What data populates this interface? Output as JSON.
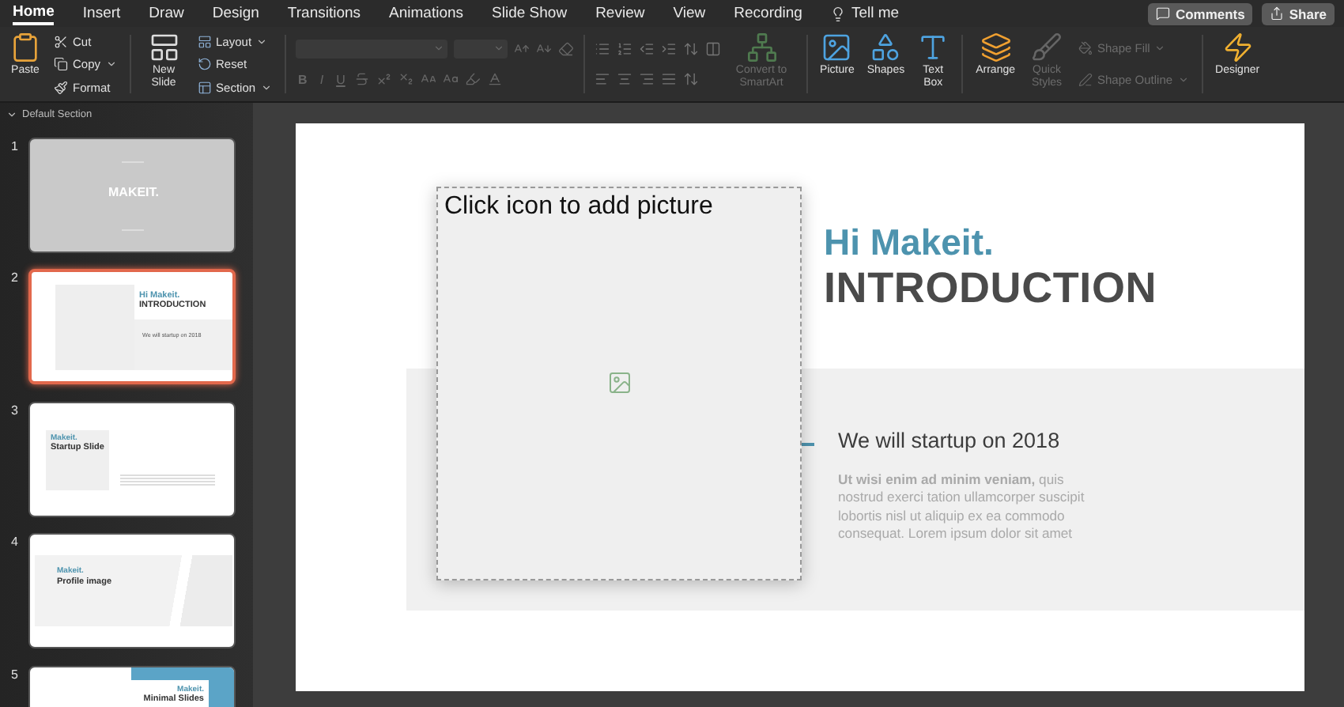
{
  "tabs": [
    {
      "label": "Home",
      "selected": true
    },
    {
      "label": "Insert",
      "selected": false
    },
    {
      "label": "Draw",
      "selected": false
    },
    {
      "label": "Design",
      "selected": false
    },
    {
      "label": "Transitions",
      "selected": false
    },
    {
      "label": "Animations",
      "selected": false
    },
    {
      "label": "Slide Show",
      "selected": false
    },
    {
      "label": "Review",
      "selected": false
    },
    {
      "label": "View",
      "selected": false
    },
    {
      "label": "Recording",
      "selected": false
    }
  ],
  "tell_me": "Tell me",
  "comments_button": "Comments",
  "share_button": "Share",
  "ribbon": {
    "paste": {
      "label": "Paste"
    },
    "clipboard": [
      {
        "label": "Cut",
        "dropdown": false
      },
      {
        "label": "Copy",
        "dropdown": true
      },
      {
        "label": "Format",
        "dropdown": false
      }
    ],
    "new_slide": {
      "label": "New Slide"
    },
    "slide_tools": [
      {
        "label": "Layout",
        "dropdown": true
      },
      {
        "label": "Reset",
        "dropdown": false
      },
      {
        "label": "Section",
        "dropdown": true
      }
    ],
    "font": {
      "disabled": true,
      "format_buttons": [
        "B",
        "I",
        "U"
      ]
    },
    "smartart": {
      "label": "Convert to SmartArt",
      "disabled": true
    },
    "insert": [
      {
        "label": "Picture"
      },
      {
        "label": "Shapes"
      },
      {
        "label": "Text Box"
      }
    ],
    "arrange": {
      "label": "Arrange"
    },
    "quick_styles": {
      "label": "Quick Styles",
      "disabled": true
    },
    "shape_format": [
      {
        "label": "Shape Fill",
        "disabled": true
      },
      {
        "label": "Shape Outline",
        "disabled": true
      }
    ],
    "designer": {
      "label": "Designer"
    }
  },
  "section": {
    "label": "Default Section",
    "expanded": true
  },
  "slides": [
    {
      "number": "1",
      "kind": "title",
      "selected": false,
      "title": "MAKEIT."
    },
    {
      "number": "2",
      "kind": "intro",
      "selected": true,
      "accent": "Hi Makeit.",
      "title": "INTRODUCTION",
      "subtitle": "We will startup on 2018"
    },
    {
      "number": "3",
      "kind": "startup",
      "selected": false,
      "accent": "Makeit.",
      "title": "Startup Slide"
    },
    {
      "number": "4",
      "kind": "profile",
      "selected": false,
      "accent": "Makeit.",
      "title": "Profile image"
    },
    {
      "number": "5",
      "kind": "minimal",
      "selected": false,
      "accent": "Makeit.",
      "title": "Minimal Slides"
    }
  ],
  "slide": {
    "placeholder": "Click icon to add picture",
    "accent": "Hi Makeit.",
    "title": "INTRODUCTION",
    "subheading": "We will startup on 2018",
    "body": "**Ut wisi enim ad minim veniam,** quis nostrud exerci tation ullamcorper suscipit lobortis nisl ut aliquip ex ea commodo consequat. Lorem ipsum dolor sit amet"
  }
}
